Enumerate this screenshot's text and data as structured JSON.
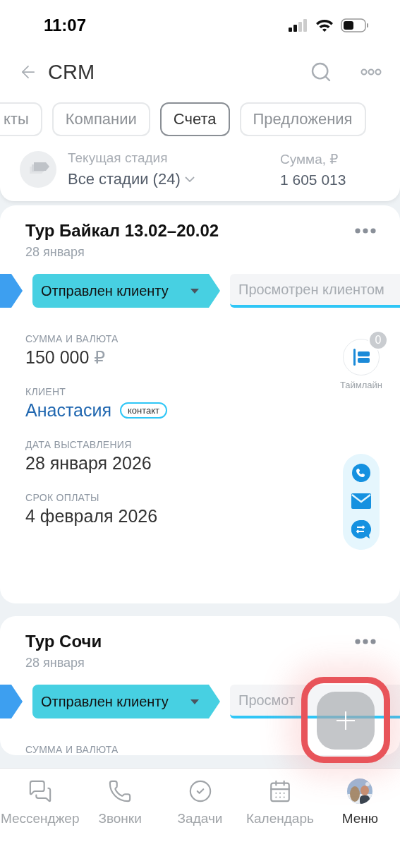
{
  "status_bar": {
    "time": "11:07"
  },
  "header": {
    "title": "CRM"
  },
  "tabs": [
    {
      "label": "кты",
      "selected": false
    },
    {
      "label": "Компании",
      "selected": false
    },
    {
      "label": "Счета",
      "selected": true
    },
    {
      "label": "Предложения",
      "selected": false
    }
  ],
  "summary": {
    "stage_label": "Текущая стадия",
    "stage_value": "Все стадии (24)",
    "sum_label": "Сумма, ₽",
    "sum_value": "1 605 013"
  },
  "cards": [
    {
      "title": "Тур Байкал 13.02–20.02",
      "date": "28 января",
      "stages": [
        {
          "kind": "previous",
          "color": "#3d9ff0"
        },
        {
          "kind": "current",
          "color": "#47d0e2",
          "label": "Отправлен клиенту"
        },
        {
          "kind": "next",
          "label": "Просмотрен клиентом"
        }
      ],
      "fields": [
        {
          "kind": "amount",
          "label": "СУММА И ВАЛЮТА",
          "value": "150 000",
          "currency": "₽"
        },
        {
          "kind": "client",
          "label": "КЛИЕНТ",
          "value": "Анастасия",
          "tag": "контакт"
        },
        {
          "kind": "text",
          "label": "ДАТА ВЫСТАВЛЕНИЯ",
          "value": "28 января 2026"
        },
        {
          "kind": "text",
          "label": "СРОК ОПЛАТЫ",
          "value": "4 февраля 2026"
        }
      ],
      "timeline": {
        "label": "Таймлайн",
        "count": "0"
      },
      "contact_actions": true
    },
    {
      "title": "Тур Сочи",
      "date": "28 января",
      "stages": [
        {
          "kind": "previous",
          "color": "#3d9ff0"
        },
        {
          "kind": "current",
          "color": "#47d0e2",
          "label": "Отправлен клиенту"
        },
        {
          "kind": "next",
          "label": "Просмот"
        }
      ],
      "fields": [
        {
          "kind": "amount",
          "label": "СУММА И ВАЛЮТА"
        }
      ],
      "contact_actions": false
    }
  ],
  "fab": {
    "highlighted": true
  },
  "bottom_nav": [
    {
      "kind": "chat",
      "label": "Мессенджер",
      "selected": false
    },
    {
      "kind": "calls",
      "label": "Звонки",
      "selected": false
    },
    {
      "kind": "tasks",
      "label": "Задачи",
      "selected": false
    },
    {
      "kind": "calendar",
      "label": "Календарь",
      "selected": false
    },
    {
      "kind": "avatar",
      "label": "Меню",
      "selected": true
    }
  ]
}
